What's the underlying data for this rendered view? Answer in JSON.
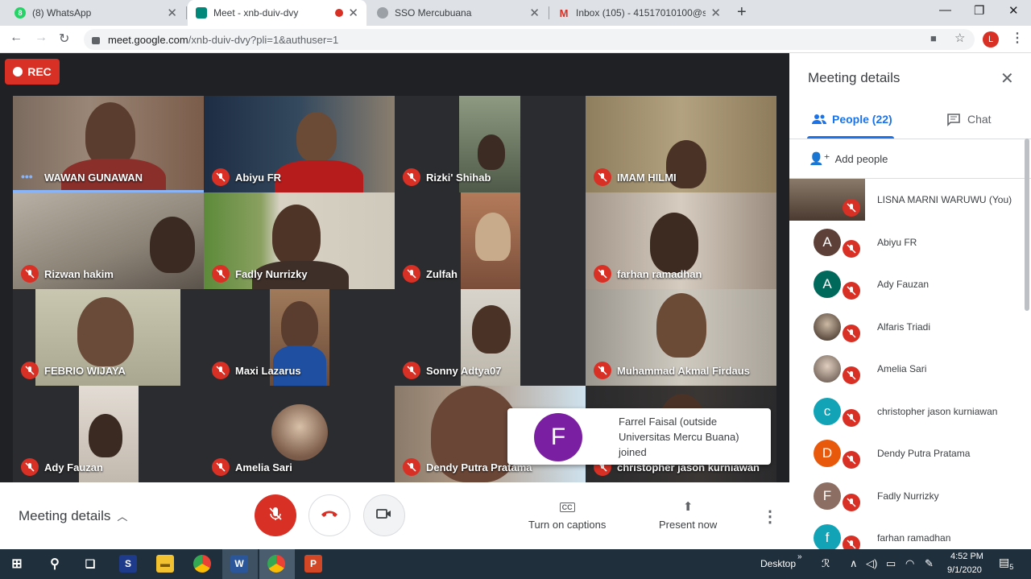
{
  "browser": {
    "tabs": [
      {
        "label": "(8) WhatsApp",
        "icon": "whatsapp-icon",
        "icon_color": "#25d366",
        "icon_glyph": "8"
      },
      {
        "label": "Meet - xnb-duiv-dvy",
        "icon": "meet-icon",
        "icon_color": "#00897b",
        "icon_glyph": ""
      },
      {
        "label": "SSO Mercubuana",
        "icon": "globe-icon",
        "icon_color": "#9aa0a6",
        "icon_glyph": ""
      },
      {
        "label": "Inbox (105) - 41517010100@stud",
        "icon": "gmail-icon",
        "icon_color": "#ffffff",
        "icon_glyph": "M"
      }
    ],
    "url_host": "meet.google.com",
    "url_rest": "/xnb-duiv-dvy?pli=1&authuser=1",
    "profile_initial": "L"
  },
  "recording": {
    "label": "REC"
  },
  "participants_grid": [
    {
      "name": "WAWAN GUNAWAN",
      "muted": false,
      "speaking": true
    },
    {
      "name": "Abiyu FR",
      "muted": true
    },
    {
      "name": "Rizki' Shihab",
      "muted": true
    },
    {
      "name": "IMAM HILMI",
      "muted": true
    },
    {
      "name": "Rizwan hakim",
      "muted": true
    },
    {
      "name": "Fadly Nurrizky",
      "muted": true
    },
    {
      "name": "Zulfah",
      "muted": true
    },
    {
      "name": "farhan ramadhan",
      "muted": true
    },
    {
      "name": "FEBRIO WIJAYA",
      "muted": true
    },
    {
      "name": "Maxi Lazarus",
      "muted": true
    },
    {
      "name": "Sonny Adtya07",
      "muted": true
    },
    {
      "name": "Muhammad Akmal Firdaus",
      "muted": true
    },
    {
      "name": "Ady Fauzan",
      "muted": true
    },
    {
      "name": "Amelia Sari",
      "muted": true
    },
    {
      "name": "Dendy Putra Pratama",
      "muted": true
    },
    {
      "name": "christopher jason kurniawan",
      "muted": true
    }
  ],
  "toast": {
    "avatar_letter": "F",
    "message": "Farrel Faisal (outside Universitas Mercu Buana) joined"
  },
  "controls": {
    "meeting_details": "Meeting details",
    "captions": "Turn on captions",
    "captions_icon": "CC",
    "present": "Present now"
  },
  "panel": {
    "title": "Meeting details",
    "people_tab": "People (22)",
    "chat_tab": "Chat",
    "add_people": "Add people",
    "people": [
      {
        "name": "LISNA MARNI WARUWU (You)",
        "avatar": "",
        "color": "#5d4a3f",
        "me": true
      },
      {
        "name": "Abiyu FR",
        "avatar": "A",
        "color": "#5d4037"
      },
      {
        "name": "Ady Fauzan",
        "avatar": "A",
        "color": "#00695c"
      },
      {
        "name": "Alfaris Triadi",
        "avatar": "",
        "color": "#8d7b6a"
      },
      {
        "name": "Amelia Sari",
        "avatar": "",
        "color": "#a08a7c"
      },
      {
        "name": "christopher jason kurniawan",
        "avatar": "c",
        "color": "#12a4b6"
      },
      {
        "name": "Dendy Putra Pratama",
        "avatar": "D",
        "color": "#e8590c"
      },
      {
        "name": "Fadly Nurrizky",
        "avatar": "F",
        "color": "#8d6e63"
      },
      {
        "name": "farhan ramadhan",
        "avatar": "f",
        "color": "#12a4b6"
      }
    ]
  },
  "taskbar": {
    "desktop_label": "Desktop",
    "time": "4:52 PM",
    "date": "9/1/2020",
    "notification_count": "5"
  }
}
